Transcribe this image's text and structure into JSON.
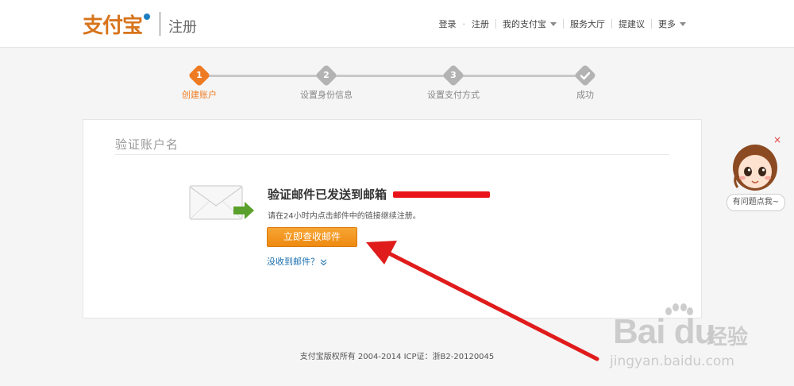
{
  "header": {
    "logo_text": "支付宝",
    "page_label": "注册",
    "nav": {
      "login": "登录",
      "separator": "·",
      "register": "注册",
      "my_alipay": "我的支付宝",
      "service_hall": "服务大厅",
      "suggest": "提建议",
      "more": "更多"
    }
  },
  "steps": [
    {
      "number": "1",
      "label": "创建账户",
      "state": "active"
    },
    {
      "number": "2",
      "label": "设置身份信息",
      "state": "pending"
    },
    {
      "number": "3",
      "label": "设置支付方式",
      "state": "pending"
    },
    {
      "number": "",
      "label": "成功",
      "state": "pending",
      "icon": "check-icon"
    }
  ],
  "card": {
    "title": "验证账户名",
    "message_title": "验证邮件已发送到邮箱",
    "message_desc": "请在24小时内点击邮件中的链接继续注册。",
    "check_button": "立即查收邮件",
    "no_mail_link": "没收到邮件？",
    "no_mail_icon": "double-chevron-down-icon"
  },
  "helper": {
    "bubble_text": "有问题点我~",
    "close": "×"
  },
  "footer": {
    "text": "支付宝版权所有  2004-2014 ICP证：浙B2-20120045"
  },
  "watermark": {
    "logo": "Bai du",
    "sub": "经验",
    "url": "jingyan.baidu.com"
  },
  "colors": {
    "brand": "#d7741c",
    "accent": "#ee7b23",
    "button": "#ee8a11",
    "link": "#1a6fb0",
    "annotation_arrow": "#e01b1b"
  }
}
